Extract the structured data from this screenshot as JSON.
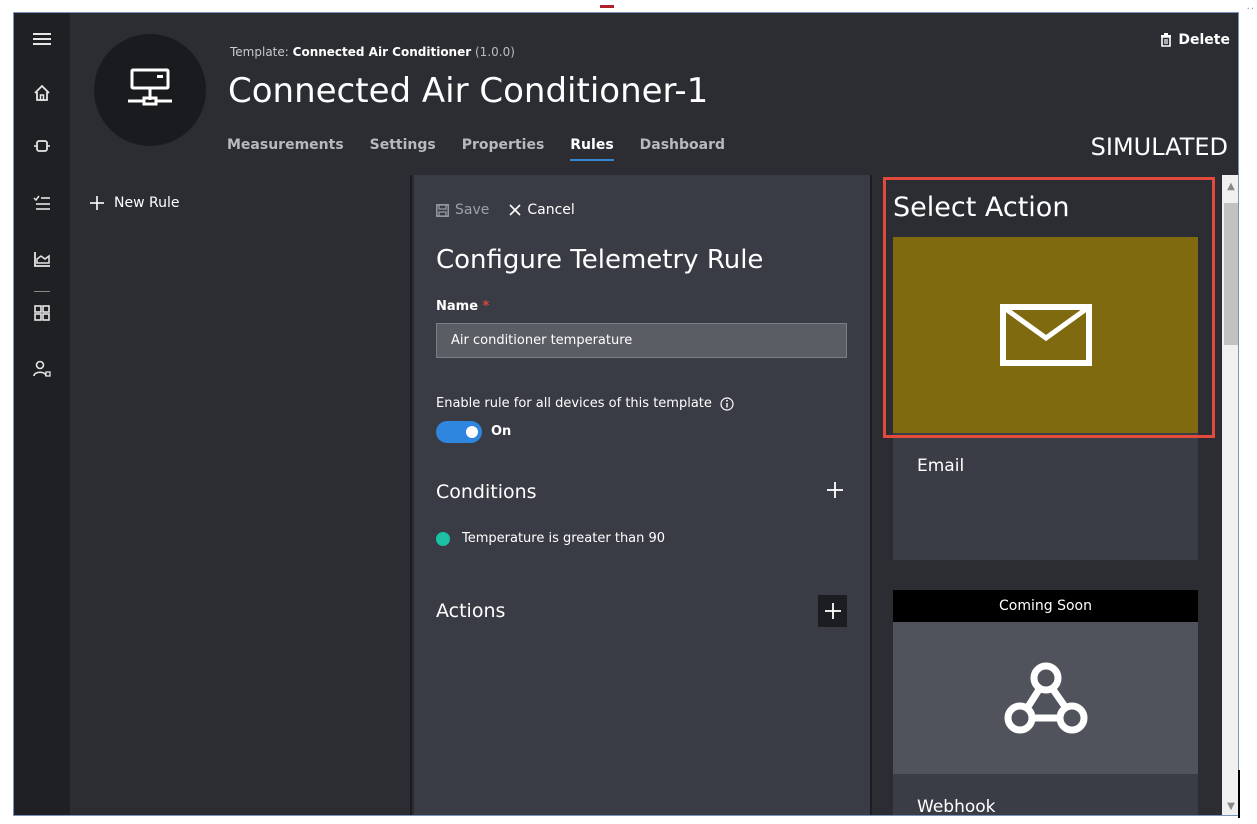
{
  "header": {
    "template_label": "Template:",
    "template_name": "Connected Air Conditioner",
    "template_version": "(1.0.0)",
    "device_title": "Connected Air Conditioner-1",
    "delete_label": "Delete",
    "status": "SIMULATED",
    "tabs": [
      {
        "label": "Measurements",
        "active": false
      },
      {
        "label": "Settings",
        "active": false
      },
      {
        "label": "Properties",
        "active": false
      },
      {
        "label": "Rules",
        "active": true
      },
      {
        "label": "Dashboard",
        "active": false
      }
    ]
  },
  "rail": {
    "icons": [
      "menu-icon",
      "home-icon",
      "devices-icon",
      "rules-list-icon",
      "analytics-icon",
      "dashboard-grid-icon",
      "users-icon"
    ]
  },
  "rules_panel": {
    "new_rule_label": "New Rule"
  },
  "config_panel": {
    "save_label": "Save",
    "cancel_label": "Cancel",
    "title": "Configure Telemetry Rule",
    "name_label": "Name",
    "required_mark": "*",
    "name_value": "Air conditioner temperature",
    "enable_label": "Enable rule for all devices of this template",
    "toggle_state": "On",
    "conditions_title": "Conditions",
    "condition_items": [
      "Temperature is greater than 90"
    ],
    "actions_title": "Actions"
  },
  "actions_panel": {
    "title": "Select Action",
    "email_label": "Email",
    "coming_soon_label": "Coming Soon",
    "webhook_label": "Webhook"
  },
  "colors": {
    "accent": "#2e86de",
    "email_card": "#806a0f",
    "highlight": "#e24a3c",
    "condition_dot": "#1bc1a2"
  }
}
